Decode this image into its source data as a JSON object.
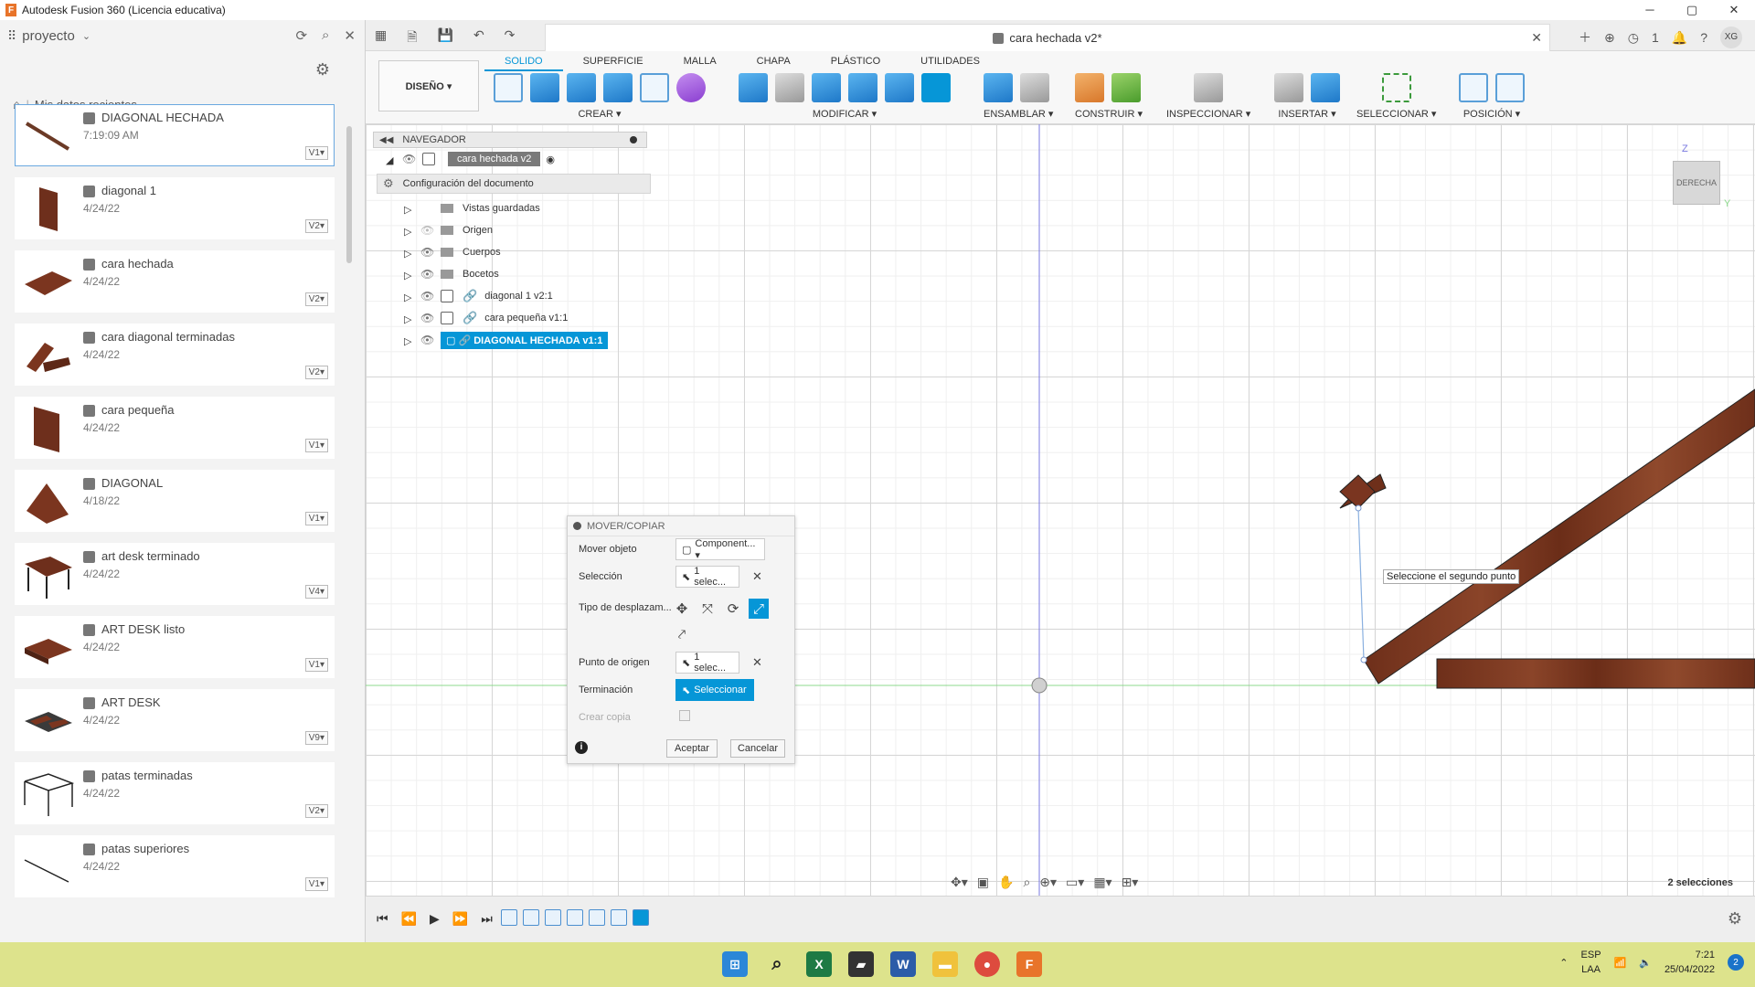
{
  "window": {
    "title": "Autodesk Fusion 360 (Licencia educativa)",
    "controls": [
      "─",
      "▢",
      "✕"
    ]
  },
  "datapanel": {
    "project": "proyecto",
    "breadcrumb": "Mis datos recientes",
    "files": [
      {
        "name": "DIAGONAL HECHADA",
        "date": "7:19:09 AM",
        "version": "V1▾"
      },
      {
        "name": "diagonal 1",
        "date": "4/24/22",
        "version": "V2▾"
      },
      {
        "name": "cara hechada",
        "date": "4/24/22",
        "version": "V2▾"
      },
      {
        "name": "cara diagonal terminadas",
        "date": "4/24/22",
        "version": "V2▾"
      },
      {
        "name": "cara pequeña",
        "date": "4/24/22",
        "version": "V1▾"
      },
      {
        "name": "DIAGONAL",
        "date": "4/18/22",
        "version": "V1▾"
      },
      {
        "name": "art desk terminado",
        "date": "4/24/22",
        "version": "V4▾"
      },
      {
        "name": "ART DESK listo",
        "date": "4/24/22",
        "version": "V1▾"
      },
      {
        "name": "ART DESK",
        "date": "4/24/22",
        "version": "V9▾"
      },
      {
        "name": "patas terminadas",
        "date": "4/24/22",
        "version": "V2▾"
      },
      {
        "name": "patas superiores",
        "date": "4/24/22",
        "version": "V1▾"
      }
    ]
  },
  "document": {
    "tab_title": "cara hechada v2*",
    "badge_count": "1",
    "user_initials": "XG"
  },
  "ribbon": {
    "workspace": "DISEÑO ▾",
    "tabs": [
      "SOLIDO",
      "SUPERFICIE",
      "MALLA",
      "CHAPA",
      "PLÁSTICO",
      "UTILIDADES"
    ],
    "groups": [
      "CREAR ▾",
      "MODIFICAR ▾",
      "ENSAMBLAR ▾",
      "CONSTRUIR ▾",
      "INSPECCIONAR ▾",
      "INSERTAR ▾",
      "SELECCIONAR ▾",
      "POSICIÓN ▾"
    ]
  },
  "navigator": {
    "title": "NAVEGADOR",
    "root": "cara hechada v2",
    "doc_settings": "Configuración del documento",
    "items": [
      "Vistas guardadas",
      "Origen",
      "Cuerpos",
      "Bocetos",
      "diagonal 1 v2:1",
      "cara pequeña v1:1",
      "DIAGONAL HECHADA v1:1"
    ]
  },
  "dialog": {
    "title": "MOVER/COPIAR",
    "move_object_label": "Mover objeto",
    "move_object_value": "Component... ▾",
    "selection_label": "Selección",
    "selection_value": "1 selec...",
    "move_type_label": "Tipo de desplazam...",
    "origin_point_label": "Punto de origen",
    "origin_point_value": "1 selec...",
    "termination_label": "Terminación",
    "termination_value": "Seleccionar",
    "create_copy_label": "Crear copia",
    "ok": "Aceptar",
    "cancel": "Cancelar"
  },
  "viewport": {
    "tooltip": "Seleccione el segundo punto",
    "viewcube_face": "DERECHA",
    "selections": "2 selecciones"
  },
  "taskbar": {
    "lang_top": "ESP",
    "lang_bottom": "LAA",
    "time": "7:21",
    "date": "25/04/2022",
    "notifications": "2"
  },
  "colors": {
    "accent": "#0696d7",
    "wood": "#7a3a22",
    "taskbar": "#dde38c"
  }
}
